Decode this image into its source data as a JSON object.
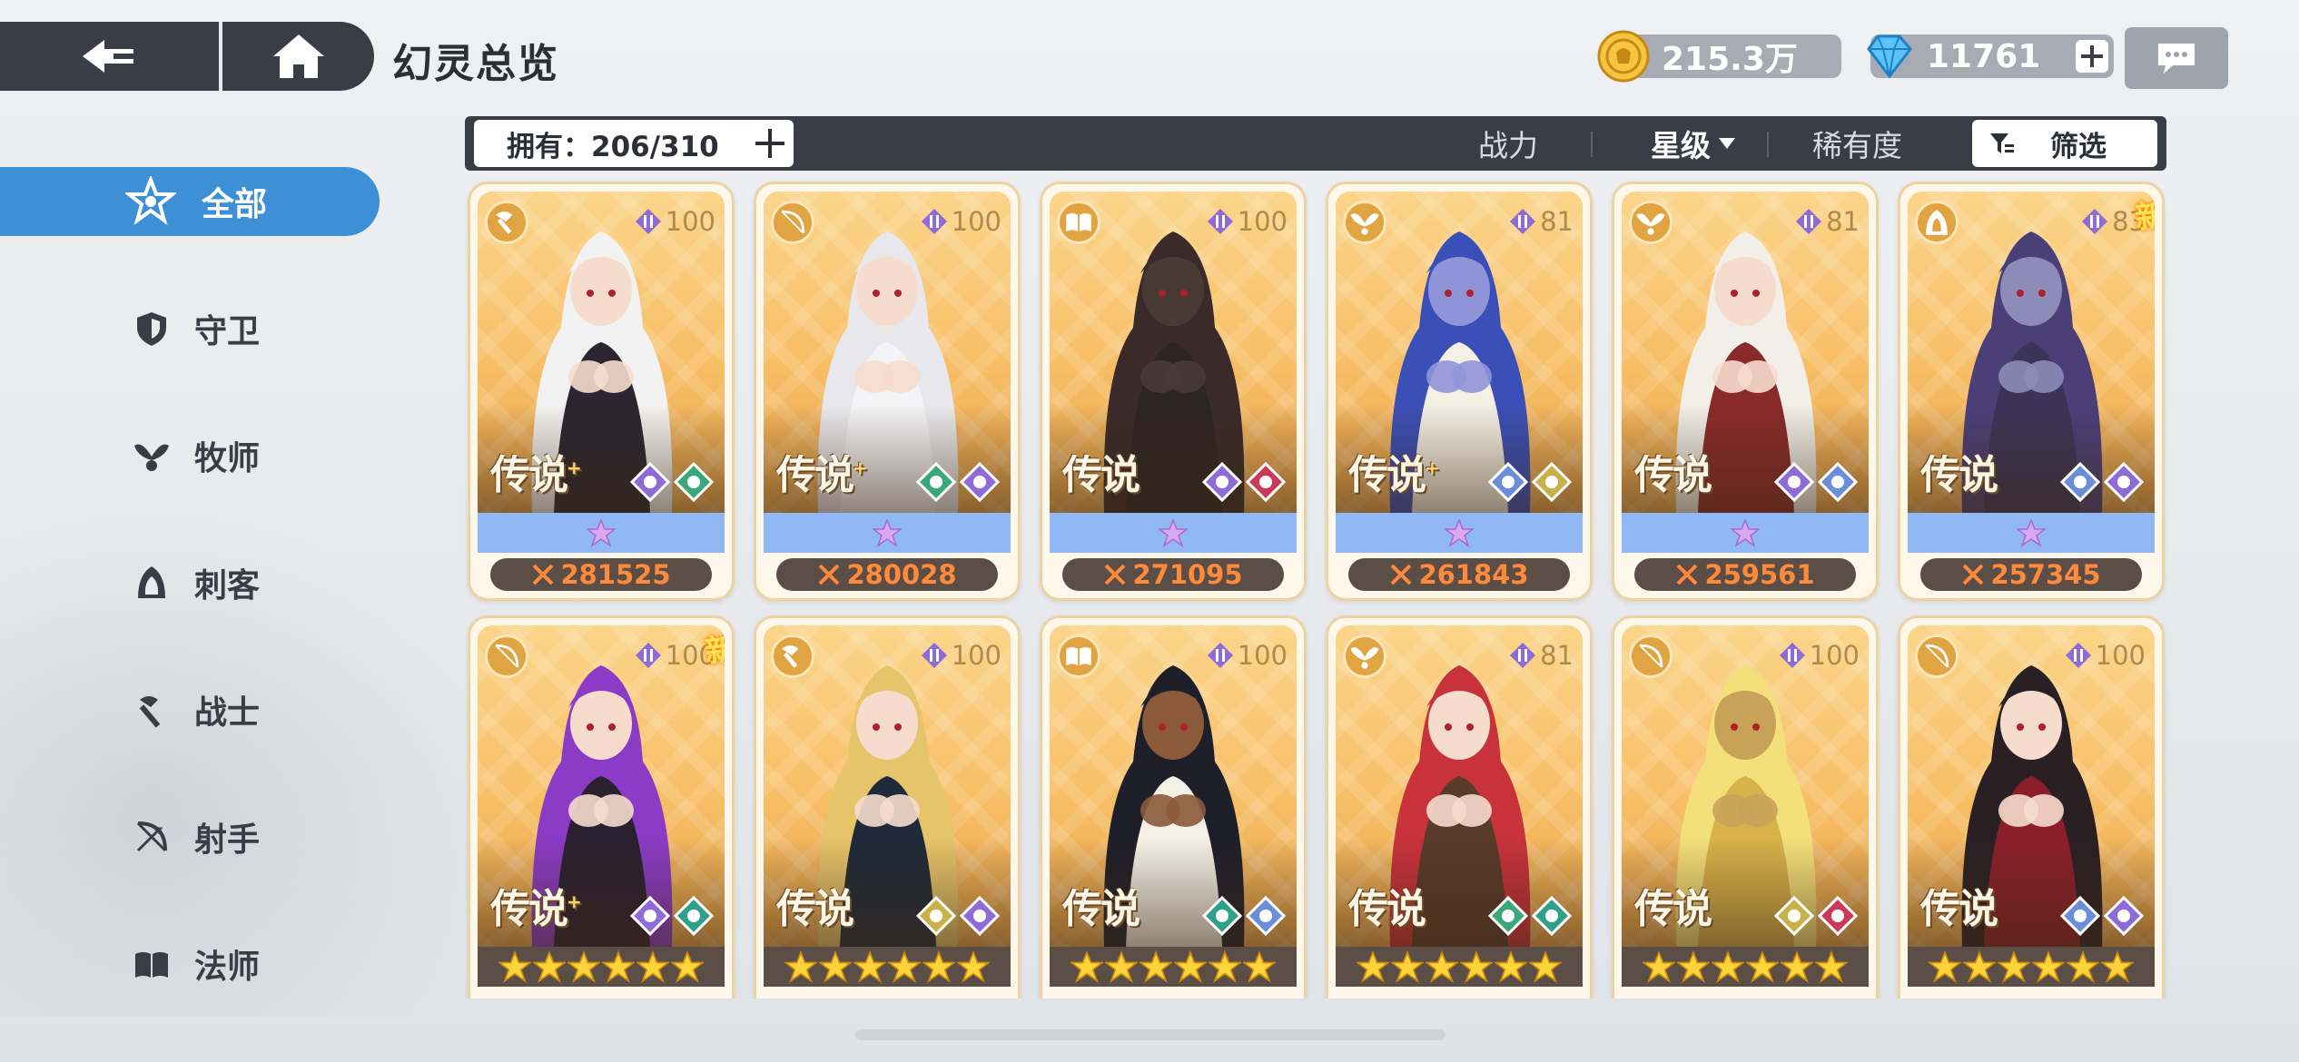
{
  "header": {
    "title": "幻灵总览",
    "back_icon": "back-arrow-icon",
    "home_icon": "home-icon",
    "gold": "215.3万",
    "gems": "11761",
    "chat_icon": "chat-bubble-icon"
  },
  "sidebar": {
    "items": [
      {
        "label": "全部",
        "icon": "all-star-icon",
        "active": true
      },
      {
        "label": "守卫",
        "icon": "shield-icon"
      },
      {
        "label": "牧师",
        "icon": "wings-icon"
      },
      {
        "label": "刺客",
        "icon": "hood-icon"
      },
      {
        "label": "战士",
        "icon": "axe-icon"
      },
      {
        "label": "射手",
        "icon": "bow-icon"
      },
      {
        "label": "法师",
        "icon": "book-icon"
      }
    ]
  },
  "filter": {
    "owned": "拥有：206/310",
    "power": "战力",
    "stars": "星级",
    "rarity": "稀有度",
    "screen": "筛选"
  },
  "colors": {
    "accent": "#3d8fd6",
    "dark": "#3a3c46",
    "power_text": "#ff8a3b",
    "card_gold": "#f7be66"
  },
  "cards": [
    {
      "level": "100",
      "rarity": "传说",
      "plus": "+",
      "power": "281525",
      "class": "axe",
      "new": "",
      "el": [
        "#8f6bd8",
        "#3aa87a"
      ],
      "hair": "#f2f2f2",
      "skin": "#f6dccd",
      "outfit": "#2a2530"
    },
    {
      "level": "100",
      "rarity": "传说",
      "plus": "+",
      "power": "280028",
      "class": "bow",
      "new": "",
      "el": [
        "#3aa87a",
        "#8f6bd8"
      ],
      "hair": "#e8e8ec",
      "skin": "#f6dccd",
      "outfit": "#f4f4f6"
    },
    {
      "level": "100",
      "rarity": "传说",
      "plus": "",
      "power": "271095",
      "class": "book",
      "new": "",
      "el": [
        "#8f6bd8",
        "#c93a5a"
      ],
      "hair": "#3a2a2a",
      "skin": "#4a3a36",
      "outfit": "#2d2424"
    },
    {
      "level": "81",
      "rarity": "传说",
      "plus": "+",
      "power": "261843",
      "class": "wings",
      "new": "",
      "el": [
        "#6a8fd8",
        "#c8b04a"
      ],
      "hair": "#3b4fb8",
      "skin": "#8f95d8",
      "outfit": "#f5f0e4"
    },
    {
      "level": "81",
      "rarity": "传说",
      "plus": "",
      "power": "259561",
      "class": "wings",
      "new": "",
      "el": [
        "#8f6bd8",
        "#6a8fd8"
      ],
      "hair": "#f2efe8",
      "skin": "#f6dccd",
      "outfit": "#8a2a2a"
    },
    {
      "level": "83",
      "rarity": "传说",
      "plus": "",
      "power": "257345",
      "class": "hood",
      "new": "新",
      "el": [
        "#6a8fd8",
        "#8f6bd8"
      ],
      "hair": "#4b3f78",
      "skin": "#8d8bb8",
      "outfit": "#3c3458"
    },
    {
      "level": "100",
      "rarity": "传说",
      "plus": "+",
      "power": "",
      "class": "bow",
      "new": "新",
      "el": [
        "#8f6bd8",
        "#2fa08a"
      ],
      "hair": "#8b3bc6",
      "skin": "#f6dccd",
      "outfit": "#2a2030"
    },
    {
      "level": "100",
      "rarity": "传说",
      "plus": "",
      "power": "",
      "class": "axe",
      "new": "",
      "el": [
        "#c8b04a",
        "#8f6bd8"
      ],
      "hair": "#e6c46a",
      "skin": "#f6dccd",
      "outfit": "#1f2a3a"
    },
    {
      "level": "100",
      "rarity": "传说",
      "plus": "",
      "power": "",
      "class": "book",
      "new": "",
      "el": [
        "#2fa08a",
        "#6a8fd8"
      ],
      "hair": "#1f1f2a",
      "skin": "#8a5a3a",
      "outfit": "#f4f0e6"
    },
    {
      "level": "81",
      "rarity": "传说",
      "plus": "",
      "power": "",
      "class": "wings",
      "new": "",
      "el": [
        "#3aa87a",
        "#2fa08a"
      ],
      "hair": "#c8323a",
      "skin": "#f6dccd",
      "outfit": "#5a3a2a"
    },
    {
      "level": "100",
      "rarity": "传说",
      "plus": "",
      "power": "",
      "class": "bow",
      "new": "",
      "el": [
        "#c8b04a",
        "#c93a5a"
      ],
      "hair": "#f4e07a",
      "skin": "#c9a25a",
      "outfit": "#d8b24a"
    },
    {
      "level": "100",
      "rarity": "传说",
      "plus": "",
      "power": "",
      "class": "bow",
      "new": "",
      "el": [
        "#6a8fd8",
        "#8f6bd8"
      ],
      "hair": "#2a2024",
      "skin": "#f6dccd",
      "outfit": "#8a1f2a"
    }
  ]
}
